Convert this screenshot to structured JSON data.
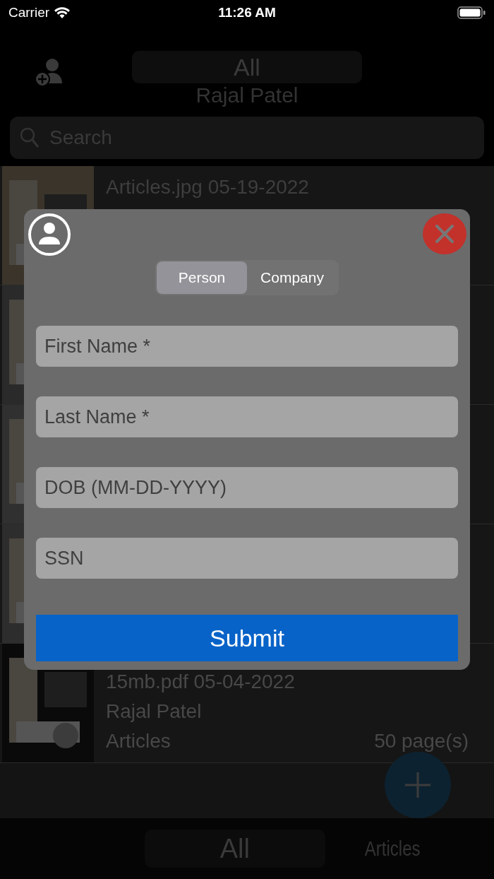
{
  "status_bar": {
    "carrier": "Carrier",
    "time": "11:26 AM"
  },
  "header": {
    "filter": "All",
    "subtitle": "Rajal Patel"
  },
  "search": {
    "placeholder": "Search"
  },
  "documents": [
    {
      "kind": "picture",
      "title": "Articles.jpg 05-19-2022"
    },
    {
      "kind": "picture"
    },
    {
      "kind": "picture"
    },
    {
      "kind": "picture"
    },
    {
      "kind": "picture",
      "title": "15mb.pdf 05-04-2022",
      "owner": "Rajal Patel",
      "category": "Articles",
      "pages": "50 page(s)"
    }
  ],
  "dialog": {
    "segments": [
      {
        "label": "Person",
        "selected": true
      },
      {
        "label": "Company",
        "selected": false
      }
    ],
    "fields": [
      {
        "placeholder": "First Name *"
      },
      {
        "placeholder": "Last Name *"
      },
      {
        "placeholder": "DOB (MM-DD-YYYY)"
      },
      {
        "placeholder": "SSN"
      }
    ],
    "submit": "Submit"
  },
  "bottom_tabs": [
    {
      "label": "All",
      "selected": true
    },
    {
      "label": "Articles",
      "selected": false
    }
  ]
}
